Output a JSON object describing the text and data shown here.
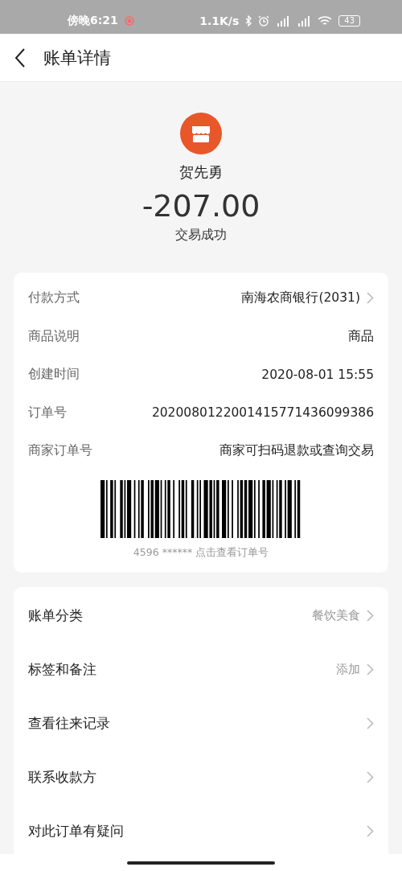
{
  "status_bar": {
    "time": "傍晚6:21",
    "speed": "1.1K/s",
    "battery": "43"
  },
  "header": {
    "title": "账单详情"
  },
  "merchant": {
    "name": "贺先勇",
    "amount": "-207.00",
    "status": "交易成功"
  },
  "details": [
    {
      "label": "付款方式",
      "value": "南海农商银行(2031)",
      "chevron": true
    },
    {
      "label": "商品说明",
      "value": "商品",
      "chevron": false
    },
    {
      "label": "创建时间",
      "value": "2020-08-01 15:55",
      "chevron": false
    },
    {
      "label": "订单号",
      "value": "2020080122001415771436099386",
      "chevron": false
    },
    {
      "label": "商家订单号",
      "value": "商家可扫码退款或查询交易",
      "chevron": false
    }
  ],
  "barcode": {
    "caption": "4596 ****** 点击查看订单号"
  },
  "actions": [
    {
      "label": "账单分类",
      "value": "餐饮美食"
    },
    {
      "label": "标签和备注",
      "value": "添加"
    },
    {
      "label": "查看往来记录"
    },
    {
      "label": "联系收款方"
    },
    {
      "label": "对此订单有疑问"
    }
  ]
}
